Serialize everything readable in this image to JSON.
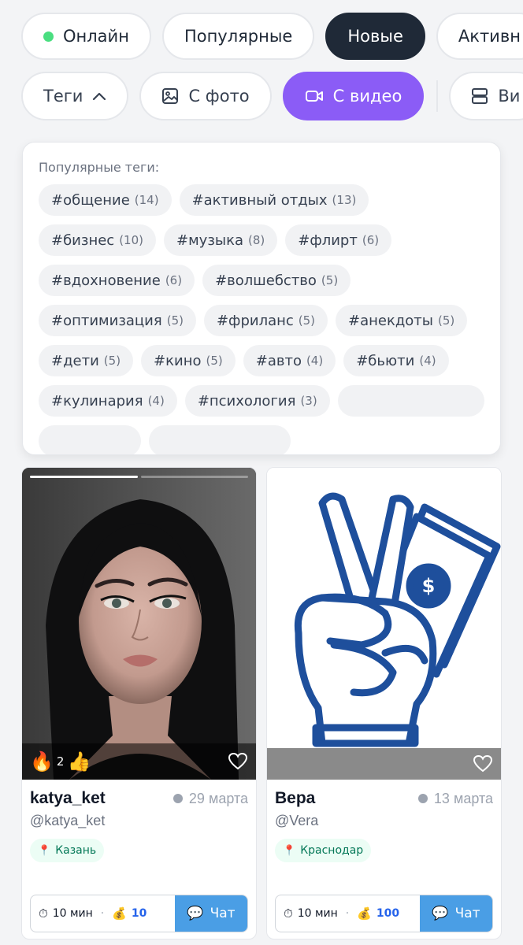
{
  "filters_row1": {
    "online": "Онлайн",
    "popular": "Популярные",
    "new": "Новые",
    "active": "Активн"
  },
  "filters_row2": {
    "tags": "Теги",
    "with_photo": "С фото",
    "with_video": "С видео",
    "view": "Ви"
  },
  "tags_panel": {
    "title": "Популярные теги:",
    "tags": [
      {
        "label": "#общение",
        "count": "(14)"
      },
      {
        "label": "#активный отдых",
        "count": "(13)"
      },
      {
        "label": "#бизнес",
        "count": "(10)"
      },
      {
        "label": "#музыка",
        "count": "(8)"
      },
      {
        "label": "#флирт",
        "count": "(6)"
      },
      {
        "label": "#вдохновение",
        "count": "(6)"
      },
      {
        "label": "#волшебство",
        "count": "(5)"
      },
      {
        "label": "#оптимизация",
        "count": "(5)"
      },
      {
        "label": "#фриланс",
        "count": "(5)"
      },
      {
        "label": "#анекдоты",
        "count": "(5)"
      },
      {
        "label": "#дети",
        "count": "(5)"
      },
      {
        "label": "#кино",
        "count": "(5)"
      },
      {
        "label": "#авто",
        "count": "(4)"
      },
      {
        "label": "#бьюти",
        "count": "(4)"
      },
      {
        "label": "#кулинария",
        "count": "(4)"
      },
      {
        "label": "#психология",
        "count": "(3)"
      }
    ]
  },
  "cards": [
    {
      "reactions_count": "2",
      "name": "katya_ket",
      "date": "29 марта",
      "handle": "@katya_ket",
      "location": "Казань",
      "duration": "10 мин",
      "coins": "10",
      "chat": "Чат"
    },
    {
      "name": "Вера",
      "date": "13 марта",
      "handle": "@Vera",
      "location": "Краснодар",
      "duration": "10 мин",
      "coins": "100",
      "chat": "Чат"
    }
  ],
  "colors": {
    "accent_violet": "#8b5cf6",
    "dark_pill": "#1f2937",
    "online_dot": "#4ade80",
    "chat_button": "#4a9ee5",
    "illustration_blue": "#1e4f9c"
  }
}
